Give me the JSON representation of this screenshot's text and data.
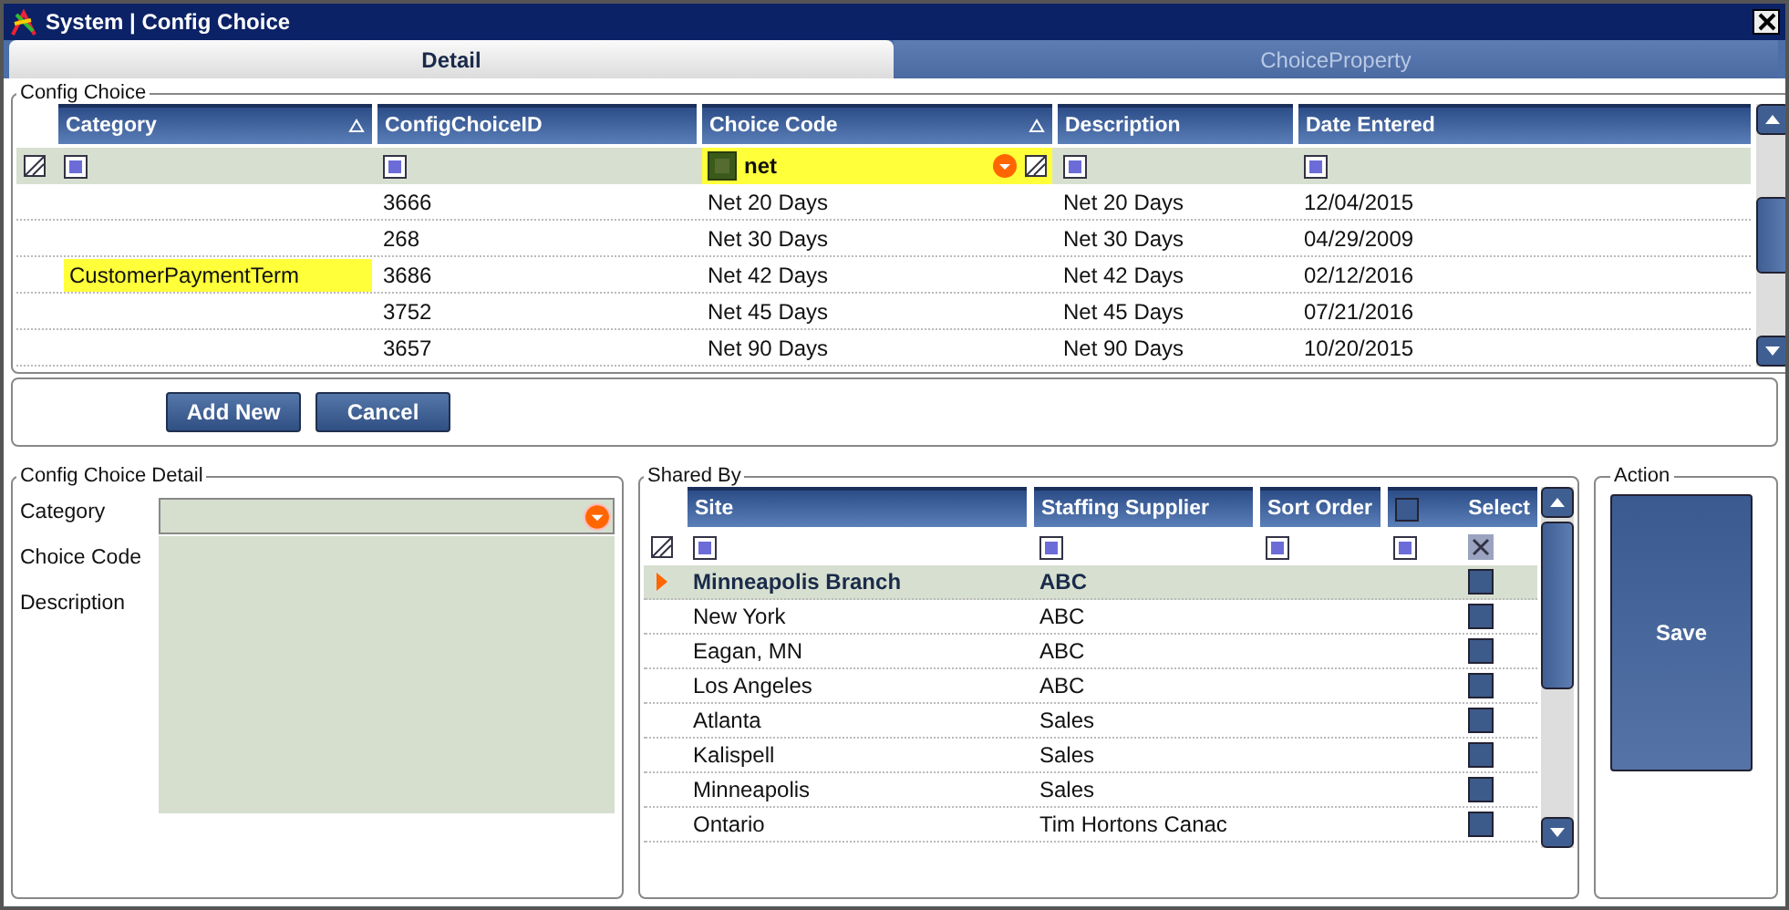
{
  "window": {
    "title": "System | Config Choice"
  },
  "tabs": [
    {
      "label": "Detail",
      "selected": true
    },
    {
      "label": "ChoiceProperty",
      "selected": false
    }
  ],
  "config_choice": {
    "title": "Config Choice",
    "columns": [
      {
        "label": "Category",
        "sorted": true
      },
      {
        "label": "ConfigChoiceID",
        "sorted": false
      },
      {
        "label": "Choice Code",
        "sorted": true,
        "filter": "net"
      },
      {
        "label": "Description",
        "sorted": false
      },
      {
        "label": "Date Entered",
        "sorted": false
      }
    ],
    "rows": [
      [
        "",
        "3666",
        "Net 20 Days",
        "Net 20 Days",
        "12/04/2015"
      ],
      [
        "",
        "268",
        "Net 30 Days",
        "Net 30 Days",
        "04/29/2009"
      ],
      [
        "CustomerPaymentTerm",
        "3686",
        "Net 42 Days",
        "Net 42 Days",
        "02/12/2016"
      ],
      [
        "",
        "3752",
        "Net 45 Days",
        "Net 45 Days",
        "07/21/2016"
      ],
      [
        "",
        "3657",
        "Net 90 Days",
        "Net 90 Days",
        "10/20/2015"
      ]
    ]
  },
  "buttons": [
    "Add New",
    "Cancel"
  ],
  "detail": {
    "title": "Config Choice  Detail",
    "fields": [
      "Category",
      "Choice Code",
      "Description"
    ]
  },
  "shared_by": {
    "title": "Shared By",
    "columns": [
      "Site",
      "Staffing Supplier",
      "Sort Order",
      "Select"
    ],
    "select_all_checked": false,
    "rows": [
      {
        "site": "Minneapolis Branch",
        "supplier": "ABC",
        "selected": true,
        "checked": false
      },
      {
        "site": "New York",
        "supplier": "ABC",
        "selected": false,
        "checked": false
      },
      {
        "site": "Eagan, MN",
        "supplier": "ABC",
        "selected": false,
        "checked": false
      },
      {
        "site": "Los Angeles",
        "supplier": "ABC",
        "selected": false,
        "checked": false
      },
      {
        "site": "Atlanta",
        "supplier": "Sales",
        "selected": false,
        "checked": false
      },
      {
        "site": "Kalispell",
        "supplier": "Sales",
        "selected": false,
        "checked": false
      },
      {
        "site": "Minneapolis",
        "supplier": "Sales",
        "selected": false,
        "checked": false
      },
      {
        "site": "Ontario",
        "supplier": "Tim Hortons Canac",
        "selected": false,
        "checked": false
      }
    ]
  },
  "action": {
    "title": "Action",
    "button": "Save"
  }
}
